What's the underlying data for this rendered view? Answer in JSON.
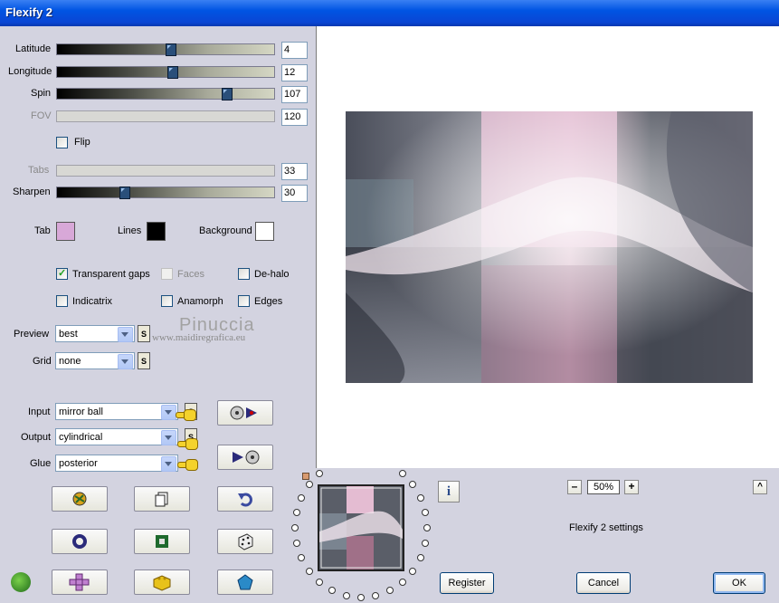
{
  "window": {
    "title": "Flexify 2"
  },
  "sliders": [
    {
      "label": "Latitude",
      "value": "4",
      "level": 0.52,
      "enabled": true
    },
    {
      "label": "Longitude",
      "value": "12",
      "level": 0.53,
      "enabled": true
    },
    {
      "label": "Spin",
      "value": "107",
      "level": 0.78,
      "enabled": true
    },
    {
      "label": "FOV",
      "value": "120",
      "level": 0,
      "enabled": false
    },
    {
      "label": "Tabs",
      "value": "33",
      "level": 0,
      "enabled": false
    },
    {
      "label": "Sharpen",
      "value": "30",
      "level": 0.31,
      "enabled": true
    }
  ],
  "flip": {
    "label": "Flip",
    "checked": false
  },
  "colors": {
    "tab_label": "Tab",
    "tab_color": "#d8a8d8",
    "lines_label": "Lines",
    "lines_color": "#000000",
    "background_label": "Background",
    "background_color": "#ffffff"
  },
  "options": {
    "transparent_gaps": {
      "label": "Transparent gaps",
      "checked": true
    },
    "faces": {
      "label": "Faces",
      "checked": false,
      "enabled": false
    },
    "de_halo": {
      "label": "De-halo",
      "checked": false
    },
    "indicatrix": {
      "label": "Indicatrix",
      "checked": false
    },
    "anamorph": {
      "label": "Anamorph",
      "checked": false
    },
    "edges": {
      "label": "Edges",
      "checked": false
    }
  },
  "preview_select": {
    "label": "Preview",
    "value": "best"
  },
  "grid_select": {
    "label": "Grid",
    "value": "none"
  },
  "s_label": "S",
  "input_select": {
    "label": "Input",
    "value": "mirror ball"
  },
  "output_select": {
    "label": "Output",
    "value": "cylindrical"
  },
  "glue_select": {
    "label": "Glue",
    "value": "posterior"
  },
  "watermark": {
    "line1": "Pinuccia",
    "line2": "www.maidiregrafica.eu"
  },
  "zoom": {
    "minus": "–",
    "value": "50%",
    "plus": "+"
  },
  "settings_label": "Flexify 2 settings",
  "buttons": {
    "register": "Register",
    "cancel": "Cancel",
    "ok": "OK",
    "info": "i",
    "collapse": "^"
  }
}
